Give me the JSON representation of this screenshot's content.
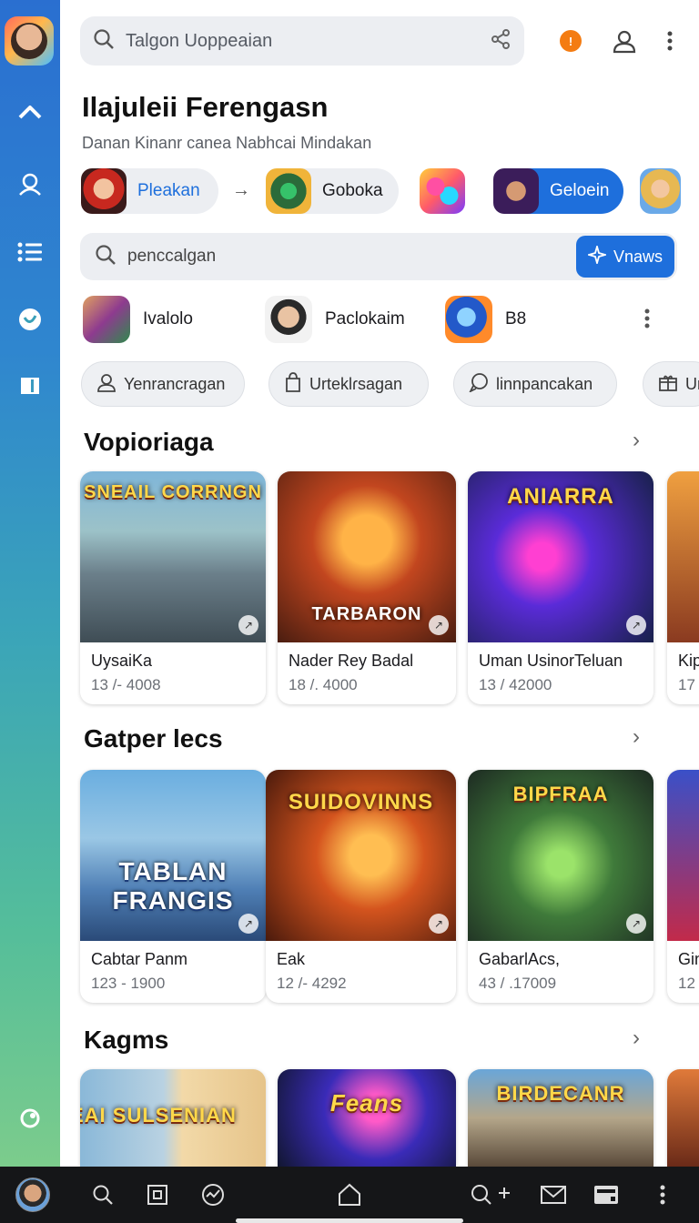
{
  "search_top": {
    "placeholder": "Talgon Uoppeaian"
  },
  "notification": {
    "count": "!"
  },
  "header": {
    "title": "Ilajuleii Ferengasn",
    "subtitle": "Danan Kinanr canea Nabhcai Mindakan"
  },
  "chips": [
    {
      "label": "Pleakan",
      "active": false
    },
    {
      "label": "Goboka",
      "active": false
    },
    {
      "label": "",
      "active": false
    },
    {
      "label": "Geloein",
      "active": true
    },
    {
      "label": "",
      "active": false
    }
  ],
  "search_secondary": {
    "placeholder": "penccalgan",
    "button_label": "Vnaws"
  },
  "games_row": [
    {
      "label": "Ivalolo"
    },
    {
      "label": "Paclokaim"
    },
    {
      "label": "B8"
    }
  ],
  "filters": [
    {
      "label": "Yenrancragan",
      "icon": "user-icon"
    },
    {
      "label": "Urteklɾsagan",
      "icon": "bag-icon"
    },
    {
      "label": "linnpancakan",
      "icon": "chat-icon"
    },
    {
      "label": "Ur",
      "icon": "gift-icon"
    }
  ],
  "sections": [
    {
      "title": "Vopioriaga",
      "cards": [
        {
          "title": "UysaiKa",
          "sub": "13 /- 4008",
          "art_text": "SNEAIL CORRNGN"
        },
        {
          "title": "Nader Rey Badal",
          "sub": "18 /. 4000",
          "art_text": "TARBARON"
        },
        {
          "title": "Uman UsinorTeluan",
          "sub": "13 / 42000",
          "art_text": "ANIARRA"
        },
        {
          "title": "Kip",
          "sub": "17",
          "art_text": ""
        }
      ]
    },
    {
      "title": "Gatper lecs",
      "cards": [
        {
          "title": "Cabtar Panm",
          "sub": "123 - 1900",
          "art_text": "TABLAN FRANGIS"
        },
        {
          "title": "Eak",
          "sub": "12 /- 4292",
          "art_text": "SUIDOVINNS"
        },
        {
          "title": "GabarlAcs,",
          "sub": "43 / .17009",
          "art_text": "BIPFRAA"
        },
        {
          "title": "Gin",
          "sub": "12",
          "art_text": ""
        }
      ]
    },
    {
      "title": "Kagms",
      "cards": [
        {
          "title": "",
          "sub": "",
          "art_text": "NEAI SULSENIAN"
        },
        {
          "title": "",
          "sub": "",
          "art_text": "Feans"
        },
        {
          "title": "",
          "sub": "",
          "art_text": "BIRDECANR"
        },
        {
          "title": "",
          "sub": "",
          "art_text": ""
        }
      ]
    }
  ],
  "colors": {
    "accent": "#1e6fdc",
    "notification": "#f47c12",
    "rail_top": "#2a6fd0",
    "rail_bottom": "#7ccc8c"
  }
}
